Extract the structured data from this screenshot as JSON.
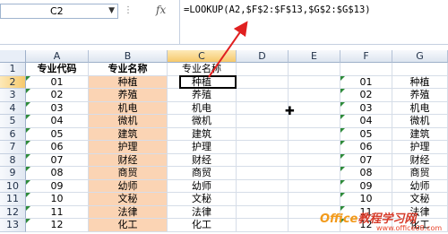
{
  "name_box": {
    "value": "C2",
    "dropdown_icon": "chevron-down-icon"
  },
  "formula_bar": {
    "fx_label": "fx",
    "formula": "=LOOKUP(A2,$F$2:$F$13,$G$2:$G$13)"
  },
  "columns": [
    "A",
    "B",
    "C",
    "D",
    "E",
    "F",
    "G"
  ],
  "rows": [
    "1",
    "2",
    "3",
    "4",
    "5",
    "6",
    "7",
    "8",
    "9",
    "10",
    "11",
    "12",
    "13"
  ],
  "headers": {
    "A": "专业代码",
    "B": "专业名称",
    "C": "专业名称"
  },
  "col_a": [
    "01",
    "02",
    "03",
    "04",
    "05",
    "06",
    "07",
    "08",
    "09",
    "10",
    "11",
    "12"
  ],
  "col_b": [
    "种植",
    "养殖",
    "机电",
    "微机",
    "建筑",
    "护理",
    "财经",
    "商贸",
    "幼师",
    "文秘",
    "法律",
    "化工"
  ],
  "col_c": [
    "种植",
    "养殖",
    "机电",
    "微机",
    "建筑",
    "护理",
    "财经",
    "商贸",
    "幼师",
    "文秘",
    "法律",
    "化工"
  ],
  "col_f": [
    "01",
    "02",
    "03",
    "04",
    "05",
    "06",
    "07",
    "08",
    "09",
    "10",
    "11",
    "12"
  ],
  "col_g": [
    "种植",
    "养殖",
    "机电",
    "微机",
    "建筑",
    "护理",
    "财经",
    "商贸",
    "幼师",
    "文秘",
    "法律",
    "化工"
  ],
  "watermark": {
    "text_a": "Office",
    "text_b": "教程学习网",
    "url": "www.office68.com"
  },
  "colors": {
    "selection": "#000000",
    "salmon_fill": "#fbd4b4",
    "arrow": "#e02020",
    "error_triangle": "#2e8b3a"
  }
}
